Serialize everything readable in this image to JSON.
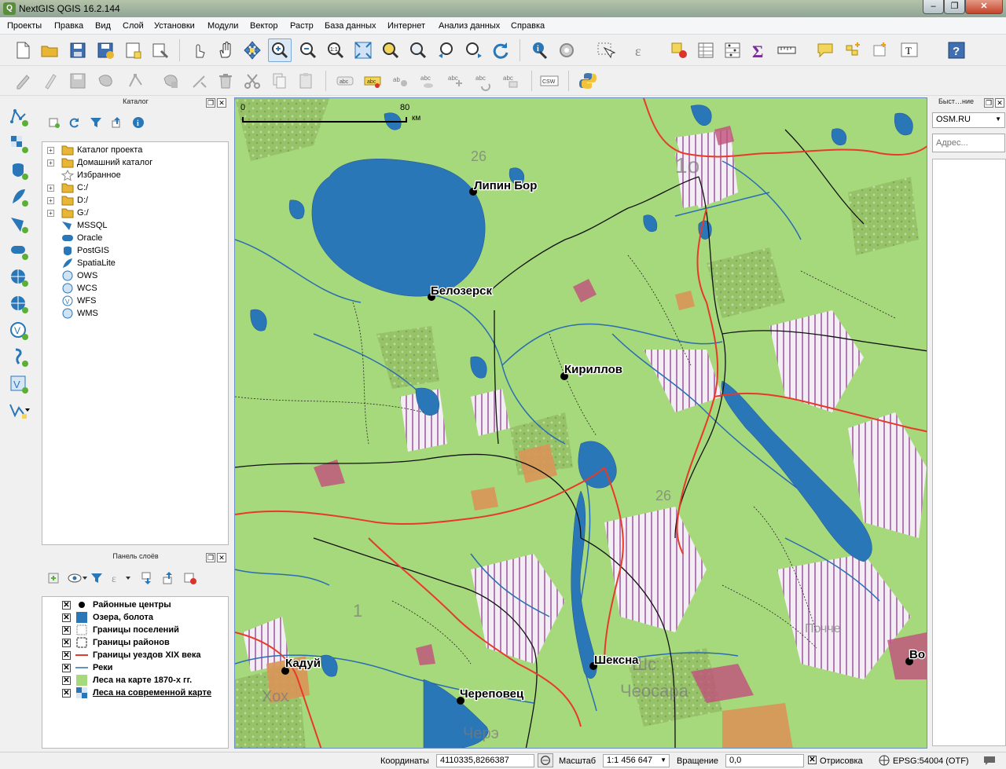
{
  "window": {
    "title": "NextGIS QGIS 16.2.144",
    "icon_letter": "Q"
  },
  "menu": [
    "Проекты",
    "Правка",
    "Вид",
    "Слой",
    "Установки",
    "Модули",
    "Вектор",
    "Растр",
    "База данных",
    "Интернет",
    "Анализ данных",
    "Справка"
  ],
  "catalog": {
    "title": "Каталог",
    "items": [
      "Каталог проекта",
      "Домашний каталог",
      "Избранное",
      "C:/",
      "D:/",
      "G:/",
      "MSSQL",
      "Oracle",
      "PostGIS",
      "SpatiaLite",
      "OWS",
      "WCS",
      "WFS",
      "WMS"
    ]
  },
  "layers_panel": {
    "title": "Панель слоёв",
    "layers": [
      "Районные центры",
      "Озера, болота",
      "Границы поселений",
      "Границы районов",
      "Границы уездов XIX века",
      "Реки",
      "Леса на карте 1870-х гг.",
      "Леса на современной карте"
    ]
  },
  "quick_panel": {
    "title": "Быст…ние",
    "provider": "OSM.RU",
    "address_placeholder": "Адрес..."
  },
  "map": {
    "scalebar": {
      "start": "0",
      "end": "80",
      "unit": "км"
    },
    "cities": [
      "Липин Бор",
      "Белозерск",
      "Кириллов",
      "Шексна",
      "Кадуй",
      "Череповец",
      "Во"
    ],
    "grid_labels": [
      "26",
      "1",
      "26",
      "Шс",
      "Чеосара",
      "Хох",
      "1о",
      "Черэ",
      "Почче",
      "Ю"
    ]
  },
  "status": {
    "coords_label": "Координаты",
    "coords_value": "4110335,8266387",
    "scale_label": "Масштаб",
    "scale_value": "1:1 456 647",
    "rotation_label": "Вращение",
    "rotation_value": "0,0",
    "render_label": "Отрисовка",
    "crs": "EPSG:54004 (OTF)"
  },
  "colors": {
    "water": "#2a77b8",
    "forest_green": "#a6d87c",
    "uezd_border": "#e8392a",
    "rivers": "#2a6db0"
  }
}
